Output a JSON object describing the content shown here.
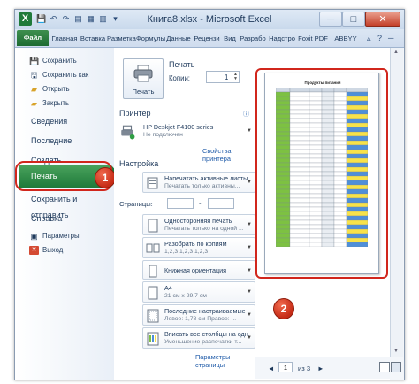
{
  "window": {
    "title": "Книга8.xlsx - Microsoft Excel",
    "logo_letter": "X",
    "minimize": "─",
    "maximize": "□",
    "close": "✕"
  },
  "ribbon": {
    "tabs": [
      "Файл",
      "Главная",
      "Вставка",
      "Разметка",
      "Формулы",
      "Данные",
      "Рецензи",
      "Вид",
      "Разрабо",
      "Надстро",
      "Foxit PDF",
      "ABBYY PC"
    ]
  },
  "nav": {
    "save": "Сохранить",
    "save_as": "Сохранить как",
    "open": "Открыть",
    "close": "Закрыть",
    "info": "Сведения",
    "recent": "Последние",
    "new": "Создать",
    "print": "Печать",
    "save_send": "Сохранить и отправить",
    "help": "Справка",
    "options": "Параметры",
    "exit": "Выход"
  },
  "callouts": {
    "one": "1",
    "two": "2"
  },
  "print": {
    "heading": "Печать",
    "button_label": "Печать",
    "copies_label": "Копии:",
    "copies_value": "1"
  },
  "printer": {
    "heading": "Принтер",
    "name": "HP Deskjet F4100 series",
    "status": "Не подключен",
    "properties_link": "Свойства принтера"
  },
  "settings": {
    "heading": "Настройка",
    "what": {
      "title": "Напечатать активные листы",
      "desc": "Печатать только активны..."
    },
    "pages_label": "Страницы:",
    "pages_dash": "-",
    "sides": {
      "title": "Односторонняя печать",
      "desc": "Печатать только на одной ..."
    },
    "collate": {
      "title": "Разобрать по копиям",
      "desc": "1,2,3   1,2,3   1,2,3"
    },
    "orientation": {
      "title": "Книжная ориентация"
    },
    "paper": {
      "title": "A4",
      "desc": "21 см x 29,7 см"
    },
    "margins": {
      "title": "Последние настраиваемые ...",
      "desc": "Левое: 1,78 см  Правое: ..."
    },
    "scaling": {
      "title": "Вписать все столбцы на одн...",
      "desc": "Уменьшение распечатки т..."
    },
    "page_setup_link": "Параметры страницы"
  },
  "preview": {
    "sheet_title": "Продукты питания",
    "current_page": "1",
    "of_pages": "из 3",
    "prev": "◄",
    "next": "►"
  },
  "colors": {
    "accent_green": "#1f7a3a",
    "highlight_red": "#d1261c",
    "table_green": "#7dc142",
    "table_yellow": "#f7e24a",
    "table_blue": "#4f8fd8"
  }
}
